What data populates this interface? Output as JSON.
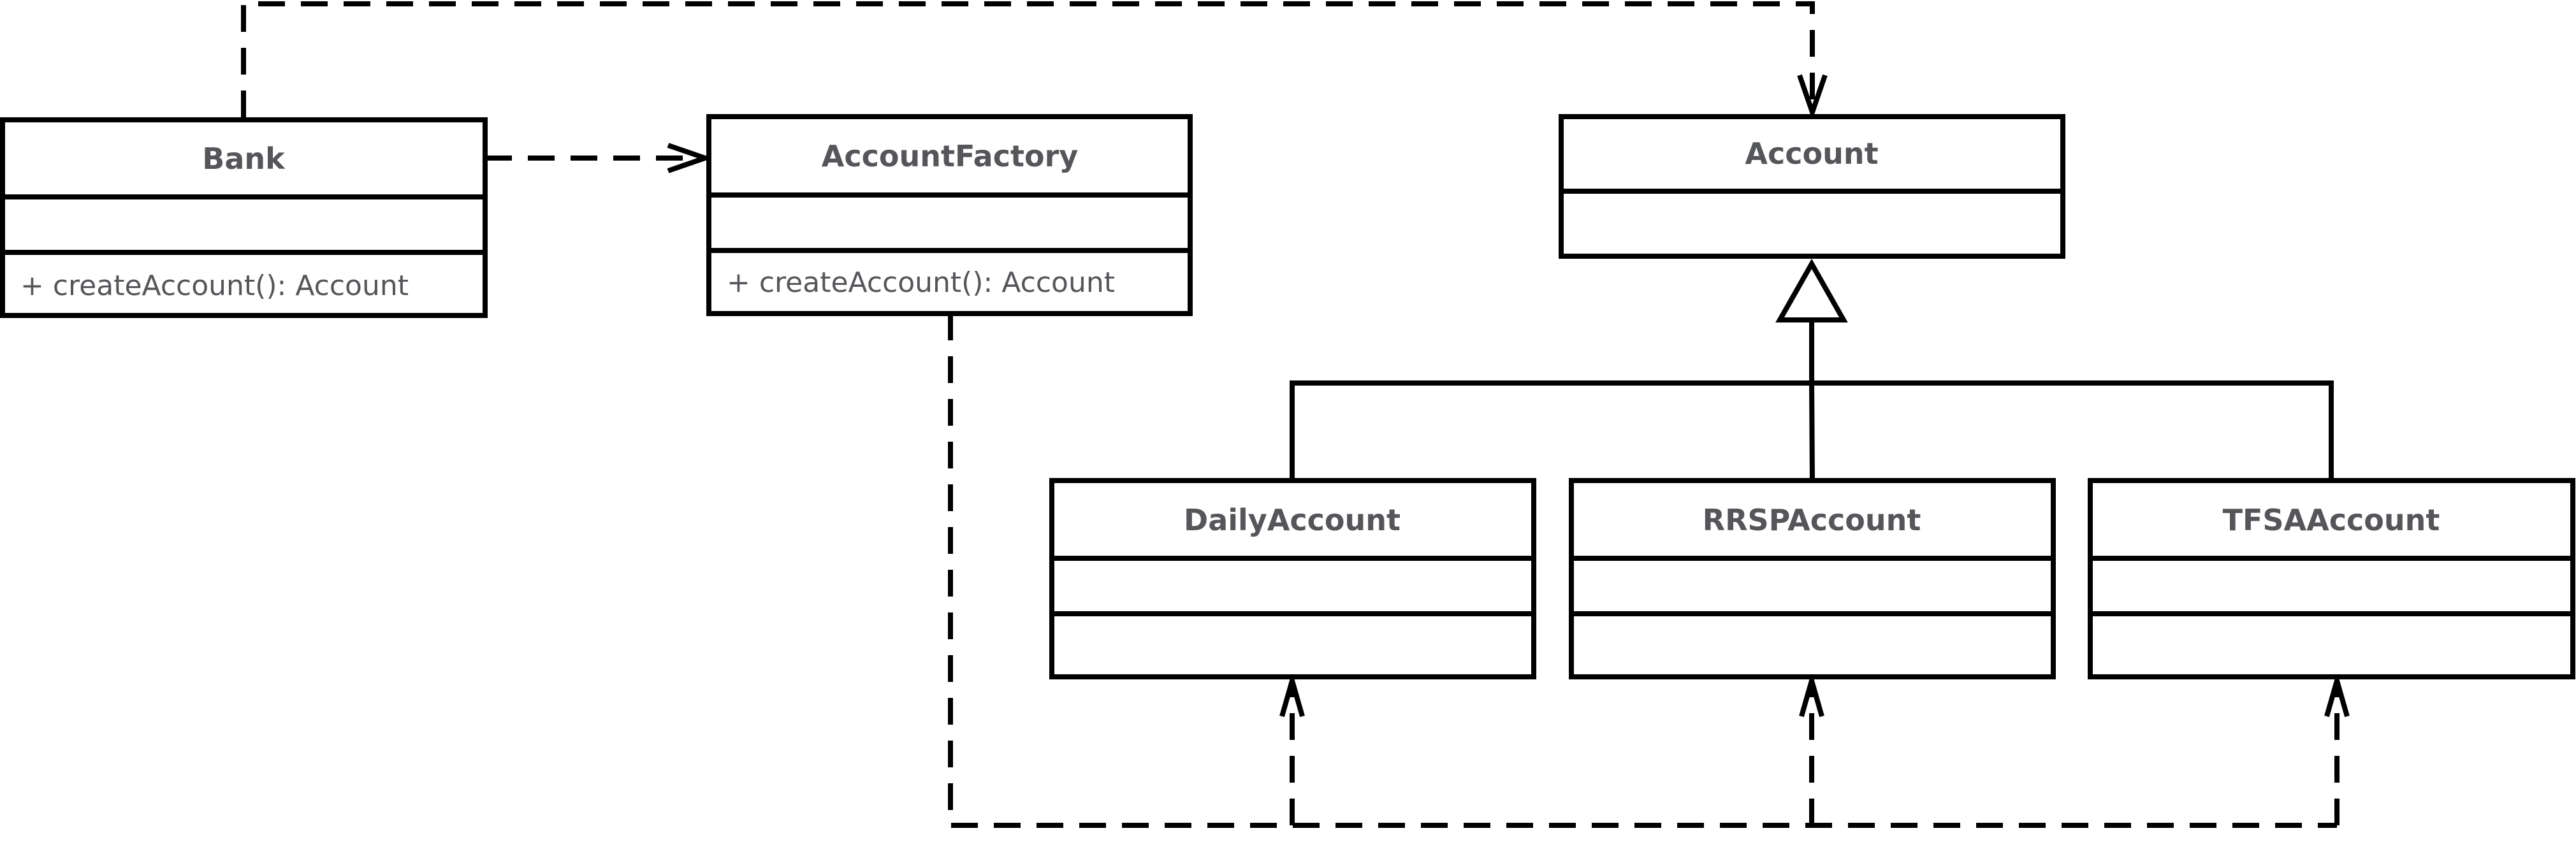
{
  "diagram": {
    "type": "UML class diagram",
    "classes": [
      {
        "id": "bank",
        "name": "Bank",
        "attributes": [],
        "operations": [
          "+ createAccount(): Account"
        ]
      },
      {
        "id": "account-factory",
        "name": "AccountFactory",
        "attributes": [],
        "operations": [
          "+ createAccount(): Account"
        ]
      },
      {
        "id": "account",
        "name": "Account",
        "attributes": [],
        "operations": null
      },
      {
        "id": "daily-account",
        "name": "DailyAccount",
        "attributes": [],
        "operations": []
      },
      {
        "id": "rrsp-account",
        "name": "RRSPAccount",
        "attributes": [],
        "operations": []
      },
      {
        "id": "tfsa-account",
        "name": "TFSAAccount",
        "attributes": [],
        "operations": []
      }
    ],
    "relationships": [
      {
        "type": "dependency",
        "from": "Bank",
        "to": "AccountFactory"
      },
      {
        "type": "dependency",
        "from": "Bank",
        "to": "Account"
      },
      {
        "type": "generalization",
        "from": "DailyAccount",
        "to": "Account"
      },
      {
        "type": "generalization",
        "from": "RRSPAccount",
        "to": "Account"
      },
      {
        "type": "generalization",
        "from": "TFSAAccount",
        "to": "Account"
      },
      {
        "type": "dependency",
        "from": "AccountFactory",
        "to": "DailyAccount"
      },
      {
        "type": "dependency",
        "from": "AccountFactory",
        "to": "RRSPAccount"
      },
      {
        "type": "dependency",
        "from": "AccountFactory",
        "to": "TFSAAccount"
      }
    ]
  },
  "labels": {
    "bank": "Bank",
    "bank_op": "+ createAccount(): Account",
    "factory": "AccountFactory",
    "factory_op": "+ createAccount(): Account",
    "account": "Account",
    "daily": "DailyAccount",
    "rrsp": "RRSPAccount",
    "tfsa": "TFSAAccount"
  },
  "colors": {
    "line": "#000000",
    "text": "#55565a",
    "background": "#ffffff"
  }
}
